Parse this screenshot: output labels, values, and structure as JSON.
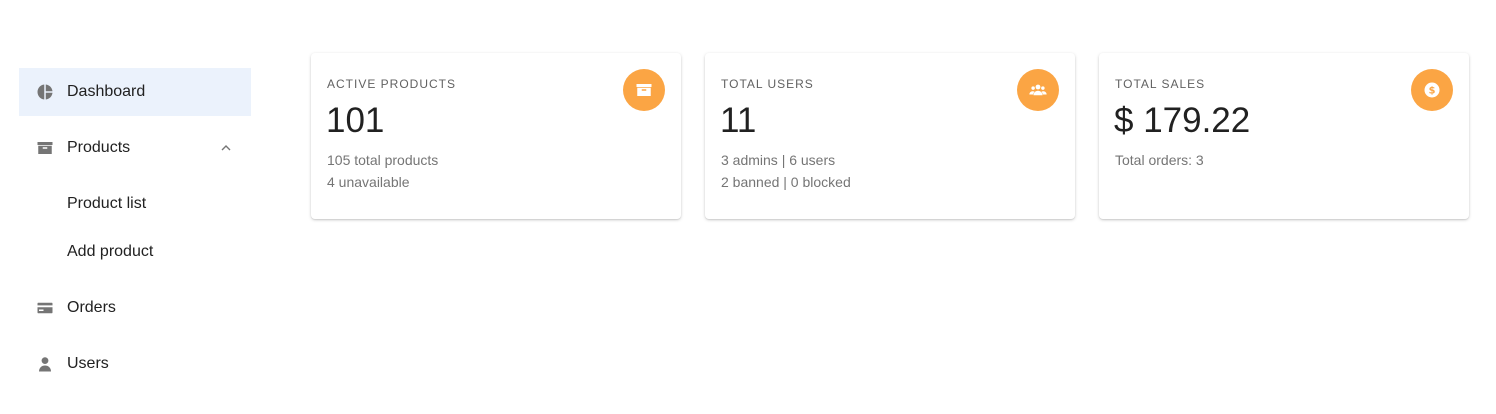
{
  "sidebar": {
    "items": [
      {
        "label": "Dashboard",
        "icon": "pie-chart-icon"
      },
      {
        "label": "Products",
        "icon": "archive-box-icon"
      },
      {
        "label": "Product list"
      },
      {
        "label": "Add product"
      },
      {
        "label": "Orders",
        "icon": "credit-card-icon"
      },
      {
        "label": "Users",
        "icon": "person-icon"
      }
    ]
  },
  "cards": [
    {
      "label": "ACTIVE PRODUCTS",
      "value": "101",
      "line1": "105 total products",
      "line2": "4 unavailable",
      "icon": "archive-box-icon"
    },
    {
      "label": "TOTAL USERS",
      "value": "11",
      "line1": "3 admins | 6 users",
      "line2": "2 banned | 0 blocked",
      "icon": "users-group-icon"
    },
    {
      "label": "TOTAL SALES",
      "value": "$ 179.22",
      "line1": "Total orders: 3",
      "icon": "dollar-coin-icon"
    }
  ],
  "colors": {
    "accent": "#fba544",
    "active_bg": "#ebf2fc",
    "icon_gray": "#757575"
  }
}
